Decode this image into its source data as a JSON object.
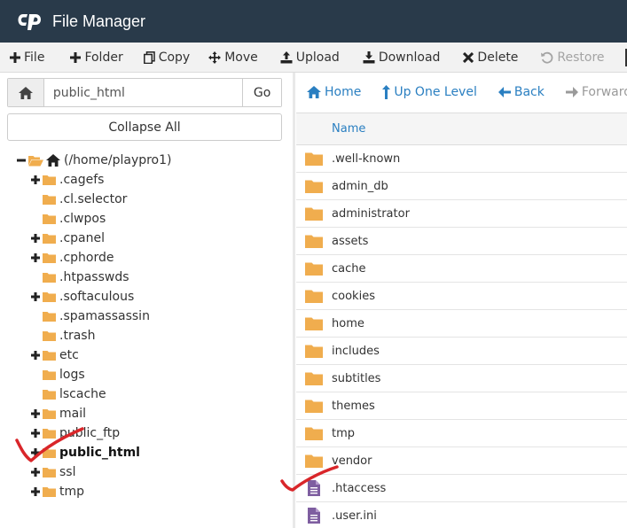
{
  "app": {
    "title": "File Manager"
  },
  "toolbar": {
    "items": [
      {
        "label": "File",
        "icon": "plus-icon",
        "disabled": false
      },
      {
        "label": "Folder",
        "icon": "plus-icon",
        "disabled": false
      },
      {
        "label": "Copy",
        "icon": "copy-icon",
        "disabled": false
      },
      {
        "label": "Move",
        "icon": "move-arrows-icon",
        "disabled": false
      },
      {
        "label": "Upload",
        "icon": "upload-icon",
        "disabled": false
      },
      {
        "label": "Download",
        "icon": "download-icon",
        "disabled": false
      },
      {
        "label": "Delete",
        "icon": "x-icon",
        "disabled": false
      },
      {
        "label": "Restore",
        "icon": "restore-icon",
        "disabled": true
      }
    ]
  },
  "path_bar": {
    "value": "public_html",
    "go_label": "Go"
  },
  "collapse_label": "Collapse All",
  "tree": {
    "root": "(/home/playpro1)",
    "items": [
      {
        "label": ".cagefs",
        "expandable": true,
        "bold": false
      },
      {
        "label": ".cl.selector",
        "expandable": false,
        "bold": false
      },
      {
        "label": ".clwpos",
        "expandable": false,
        "bold": false
      },
      {
        "label": ".cpanel",
        "expandable": true,
        "bold": false
      },
      {
        "label": ".cphorde",
        "expandable": true,
        "bold": false
      },
      {
        "label": ".htpasswds",
        "expandable": false,
        "bold": false
      },
      {
        "label": ".softaculous",
        "expandable": true,
        "bold": false
      },
      {
        "label": ".spamassassin",
        "expandable": false,
        "bold": false
      },
      {
        "label": ".trash",
        "expandable": false,
        "bold": false
      },
      {
        "label": "etc",
        "expandable": true,
        "bold": false
      },
      {
        "label": "logs",
        "expandable": false,
        "bold": false
      },
      {
        "label": "lscache",
        "expandable": false,
        "bold": false
      },
      {
        "label": "mail",
        "expandable": true,
        "bold": false
      },
      {
        "label": "public_ftp",
        "expandable": true,
        "bold": false
      },
      {
        "label": "public_html",
        "expandable": true,
        "bold": true
      },
      {
        "label": "ssl",
        "expandable": true,
        "bold": false
      },
      {
        "label": "tmp",
        "expandable": true,
        "bold": false
      }
    ]
  },
  "nav": {
    "items": [
      {
        "label": "Home",
        "icon": "home-icon",
        "disabled": false
      },
      {
        "label": "Up One Level",
        "icon": "level-up-icon",
        "disabled": false
      },
      {
        "label": "Back",
        "icon": "arrow-left-icon",
        "disabled": false
      },
      {
        "label": "Forward",
        "icon": "arrow-right-icon",
        "disabled": true
      }
    ]
  },
  "files": {
    "header": "Name",
    "rows": [
      {
        "name": ".well-known",
        "type": "folder"
      },
      {
        "name": "admin_db",
        "type": "folder"
      },
      {
        "name": "administrator",
        "type": "folder"
      },
      {
        "name": "assets",
        "type": "folder"
      },
      {
        "name": "cache",
        "type": "folder"
      },
      {
        "name": "cookies",
        "type": "folder"
      },
      {
        "name": "home",
        "type": "folder"
      },
      {
        "name": "includes",
        "type": "folder"
      },
      {
        "name": "subtitles",
        "type": "folder"
      },
      {
        "name": "themes",
        "type": "folder"
      },
      {
        "name": "tmp",
        "type": "folder"
      },
      {
        "name": "vendor",
        "type": "folder"
      },
      {
        "name": ".htaccess",
        "type": "file"
      },
      {
        "name": ".user.ini",
        "type": "file"
      }
    ]
  },
  "colors": {
    "header_bg": "#293a4a",
    "link_blue": "#2a7fc1",
    "folder": "#f0ad4e",
    "file": "#7e5ea0",
    "annotation_red": "#d9262a"
  }
}
